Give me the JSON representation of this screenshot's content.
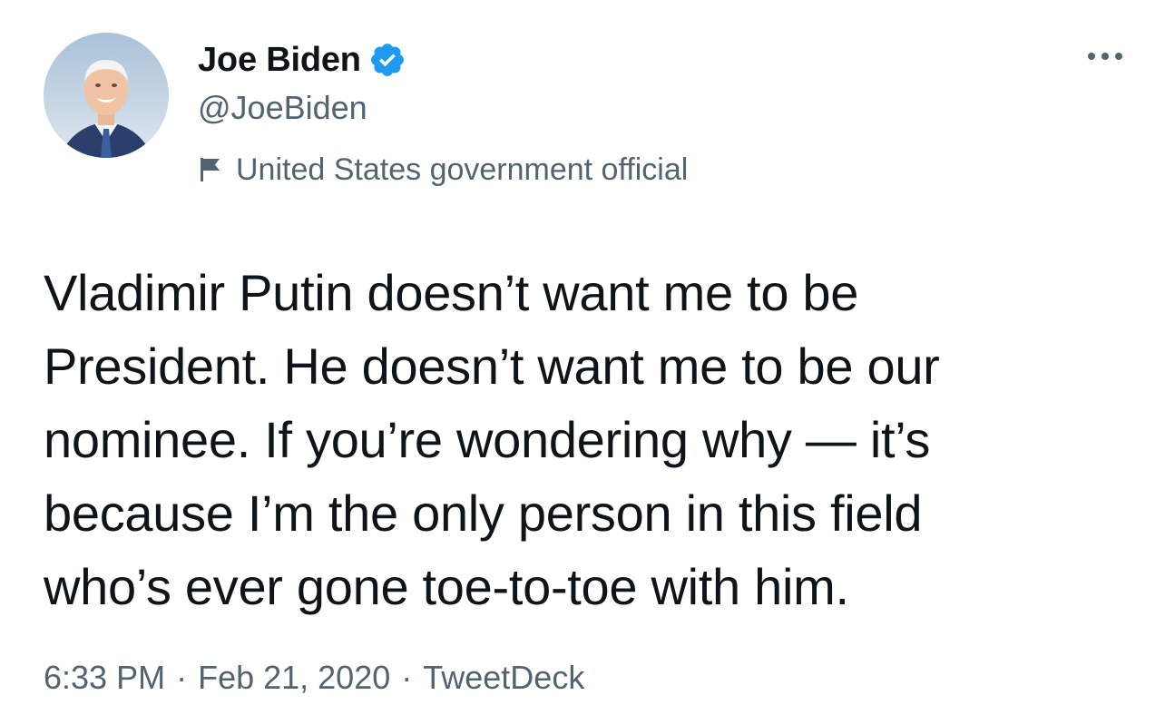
{
  "author": {
    "display_name": "Joe Biden",
    "handle": "@JoeBiden",
    "verified": true,
    "label": "United States government official"
  },
  "tweet": {
    "text": "Vladimir Putin doesn’t want me to be\nPresident. He doesn’t want me to be our\nnominee. If you’re wondering why — it’s\nbecause I’m the only person in this field\nwho’s ever gone toe-to-toe with him."
  },
  "meta": {
    "time": "6:33 PM",
    "separator": "·",
    "date": "Feb 21, 2020",
    "source": "TweetDeck"
  },
  "icons": {
    "verified": "verified-badge-icon",
    "label": "flag-icon",
    "more": "more-options-icon",
    "avatar": "profile-photo"
  },
  "colors": {
    "verified_blue": "#1d9bf0",
    "text_primary": "#0f1419",
    "text_secondary": "#536471"
  }
}
